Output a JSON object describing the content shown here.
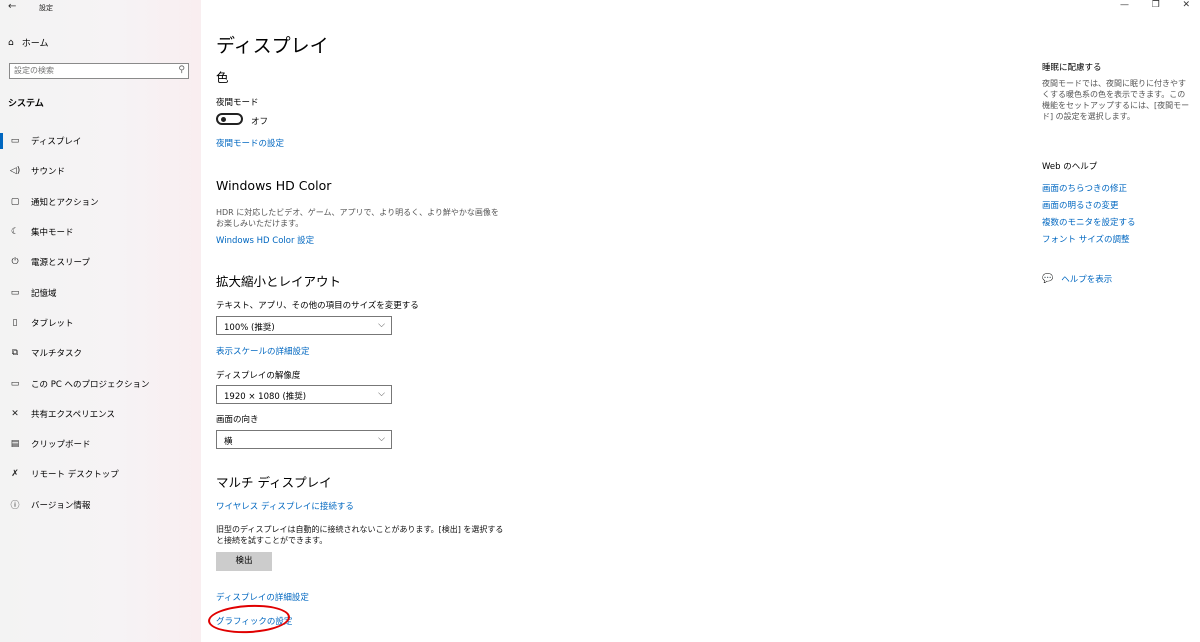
{
  "window": {
    "title": "設定",
    "back_icon": "back-arrow-icon",
    "minimize": "—",
    "maximize": "❐",
    "close": "✕"
  },
  "sidebar": {
    "home_label": "ホーム",
    "search_placeholder": "設定の検索",
    "section": "システム",
    "items": [
      {
        "label": "ディスプレイ",
        "icon": "display-icon",
        "glyph": "▭"
      },
      {
        "label": "サウンド",
        "icon": "speaker-icon",
        "glyph": "🔈"
      },
      {
        "label": "通知とアクション",
        "icon": "notification-icon",
        "glyph": "▢"
      },
      {
        "label": "集中モード",
        "icon": "moon-icon",
        "glyph": "☾"
      },
      {
        "label": "電源とスリープ",
        "icon": "power-icon",
        "glyph": "⏻"
      },
      {
        "label": "記憶域",
        "icon": "storage-icon",
        "glyph": "▭"
      },
      {
        "label": "タブレット",
        "icon": "tablet-icon",
        "glyph": "▯"
      },
      {
        "label": "マルチタスク",
        "icon": "multitask-icon",
        "glyph": "⧉"
      },
      {
        "label": "この PC へのプロジェクション",
        "icon": "projection-icon",
        "glyph": "▭"
      },
      {
        "label": "共有エクスペリエンス",
        "icon": "shared-icon",
        "glyph": "✕"
      },
      {
        "label": "クリップボード",
        "icon": "clipboard-icon",
        "glyph": "▤"
      },
      {
        "label": "リモート デスクトップ",
        "icon": "remote-icon",
        "glyph": "✗"
      },
      {
        "label": "バージョン情報",
        "icon": "info-icon",
        "glyph": "ⓘ"
      }
    ]
  },
  "main": {
    "title": "ディスプレイ",
    "color": {
      "heading": "色",
      "night_label": "夜間モード",
      "night_state": "オフ",
      "night_link": "夜間モードの設定"
    },
    "hdr": {
      "heading": "Windows HD Color",
      "desc": "HDR に対応したビデオ、ゲーム、アプリで、より明るく、より鮮やかな画像をお楽しみいただけます。",
      "link": "Windows HD Color 設定"
    },
    "scale": {
      "heading": "拡大縮小とレイアウト",
      "size_label": "テキスト、アプリ、その他の項目のサイズを変更する",
      "size_value": "100% (推奨)",
      "advanced_link": "表示スケールの詳細設定",
      "resolution_label": "ディスプレイの解像度",
      "resolution_value": "1920 × 1080 (推奨)",
      "orientation_label": "画面の向き",
      "orientation_value": "横"
    },
    "multi": {
      "heading": "マルチ ディスプレイ",
      "wireless_link": "ワイヤレス ディスプレイに接続する",
      "desc": "旧型のディスプレイは自動的に接続されないことがあります。[検出] を選択すると接続を試すことができます。",
      "detect_button": "検出",
      "advanced_link": "ディスプレイの詳細設定",
      "graphics_link": "グラフィックの設定"
    }
  },
  "right": {
    "sleep_title": "睡眠に配慮する",
    "sleep_desc": "夜間モードでは、夜間に眠りに付きやすくする暖色系の色を表示できます。この機能をセットアップするには、[夜間モード] の設定を選択します。",
    "web_help_title": "Web のヘルプ",
    "links": [
      "画面のちらつきの修正",
      "画面の明るさの変更",
      "複数のモニタを設定する",
      "フォント サイズの調整"
    ],
    "help_label": "ヘルプを表示"
  },
  "colors": {
    "accent": "#0067c0",
    "annotation": "#e00000"
  }
}
